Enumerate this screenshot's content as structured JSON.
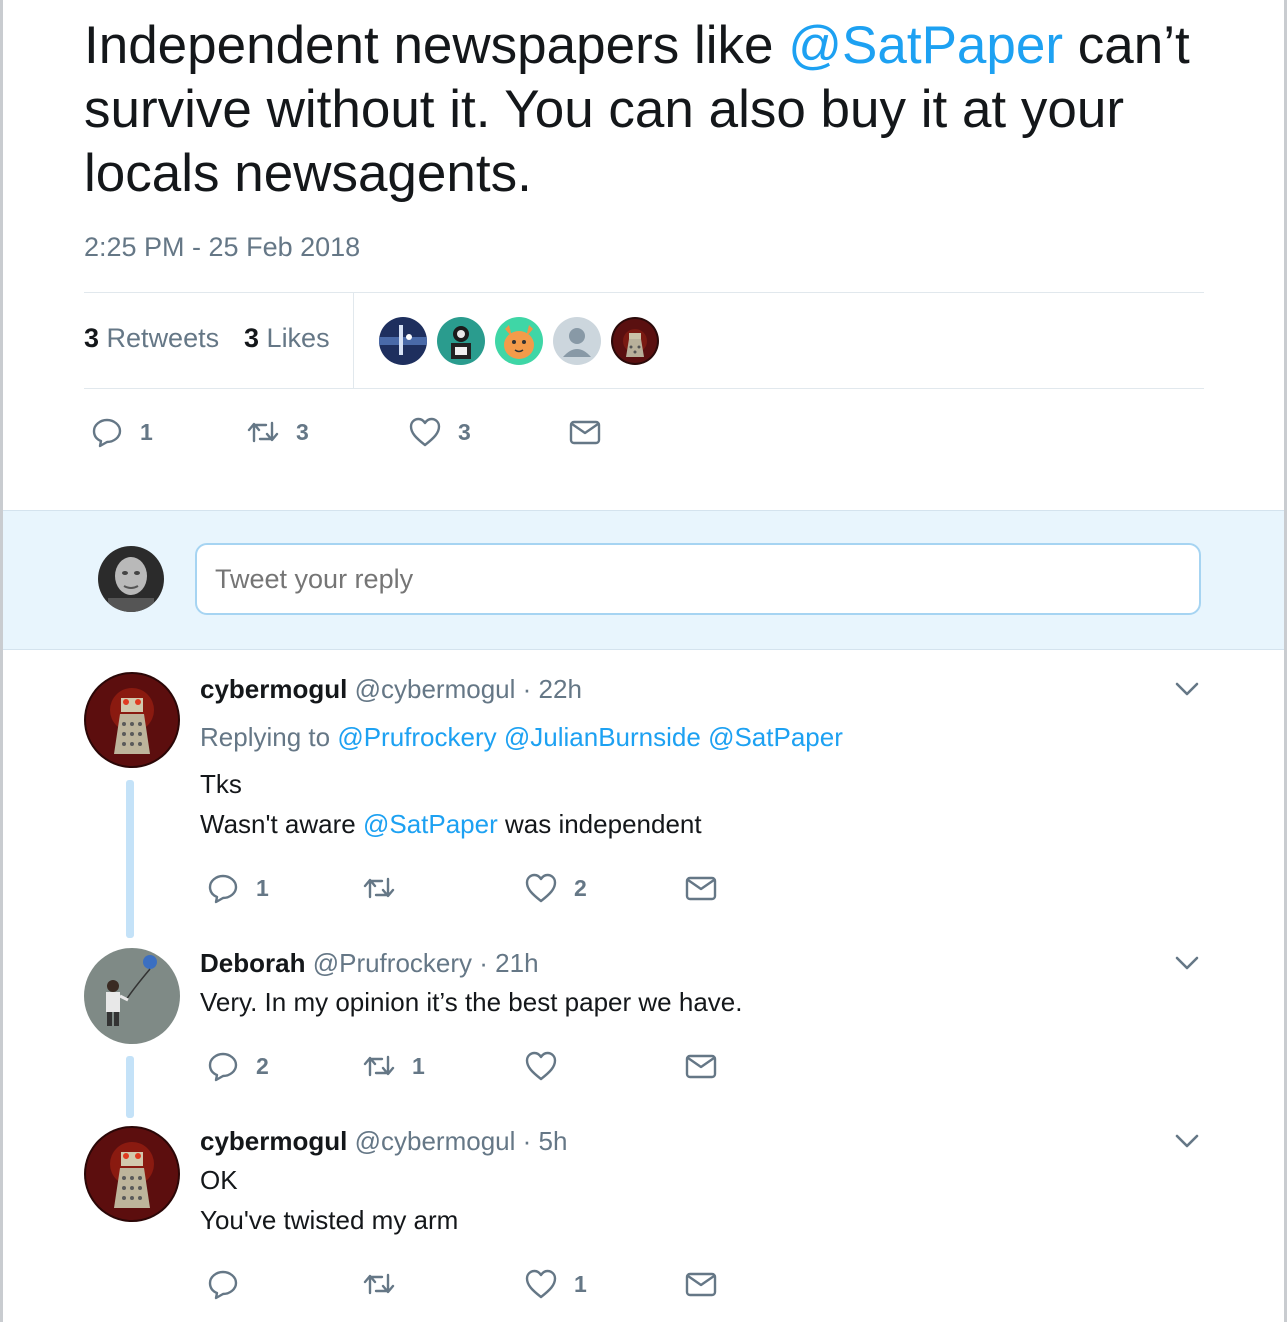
{
  "tweet": {
    "text_pre": "Independent newspapers like ",
    "mention": "@SatPaper",
    "text_post": " can’t survive without it. You can also buy it at your locals newsagents.",
    "timestamp": "2:25 PM - 25 Feb 2018",
    "retweets_count": "3",
    "retweets_label": "Retweets",
    "likes_count": "3",
    "likes_label": "Likes",
    "actions": {
      "reply_count": "1",
      "retweet_count": "3",
      "like_count": "3"
    }
  },
  "reply_box": {
    "placeholder": "Tweet your reply"
  },
  "replies": [
    {
      "name": "cybermogul",
      "handle": "@cybermogul",
      "time": "· 22h",
      "replying_label": "Replying to",
      "replying_to": [
        "@Prufrockery",
        "@JulianBurnside",
        "@SatPaper"
      ],
      "line1": "Tks",
      "line2_pre": "Wasn't aware ",
      "line2_mention": "@SatPaper",
      "line2_post": " was independent",
      "reply_count": "1",
      "retweet_count": "",
      "like_count": "2"
    },
    {
      "name": "Deborah",
      "handle": "@Prufrockery",
      "time": "· 21h",
      "line1": "Very. In my opinion it’s the best paper we have.",
      "reply_count": "2",
      "retweet_count": "1",
      "like_count": ""
    },
    {
      "name": "cybermogul",
      "handle": "@cybermogul",
      "time": "· 5h",
      "line1": "OK",
      "line2": "You've twisted my arm",
      "reply_count": "",
      "retweet_count": "",
      "like_count": "1"
    }
  ],
  "icons": {
    "reply": "reply-icon",
    "retweet": "retweet-icon",
    "like": "heart-icon",
    "message": "envelope-icon",
    "more": "chevron-down-icon"
  },
  "colors": {
    "accent": "#1da1f2",
    "secondary_text": "#657786",
    "reply_bg": "#e8f5fd"
  }
}
